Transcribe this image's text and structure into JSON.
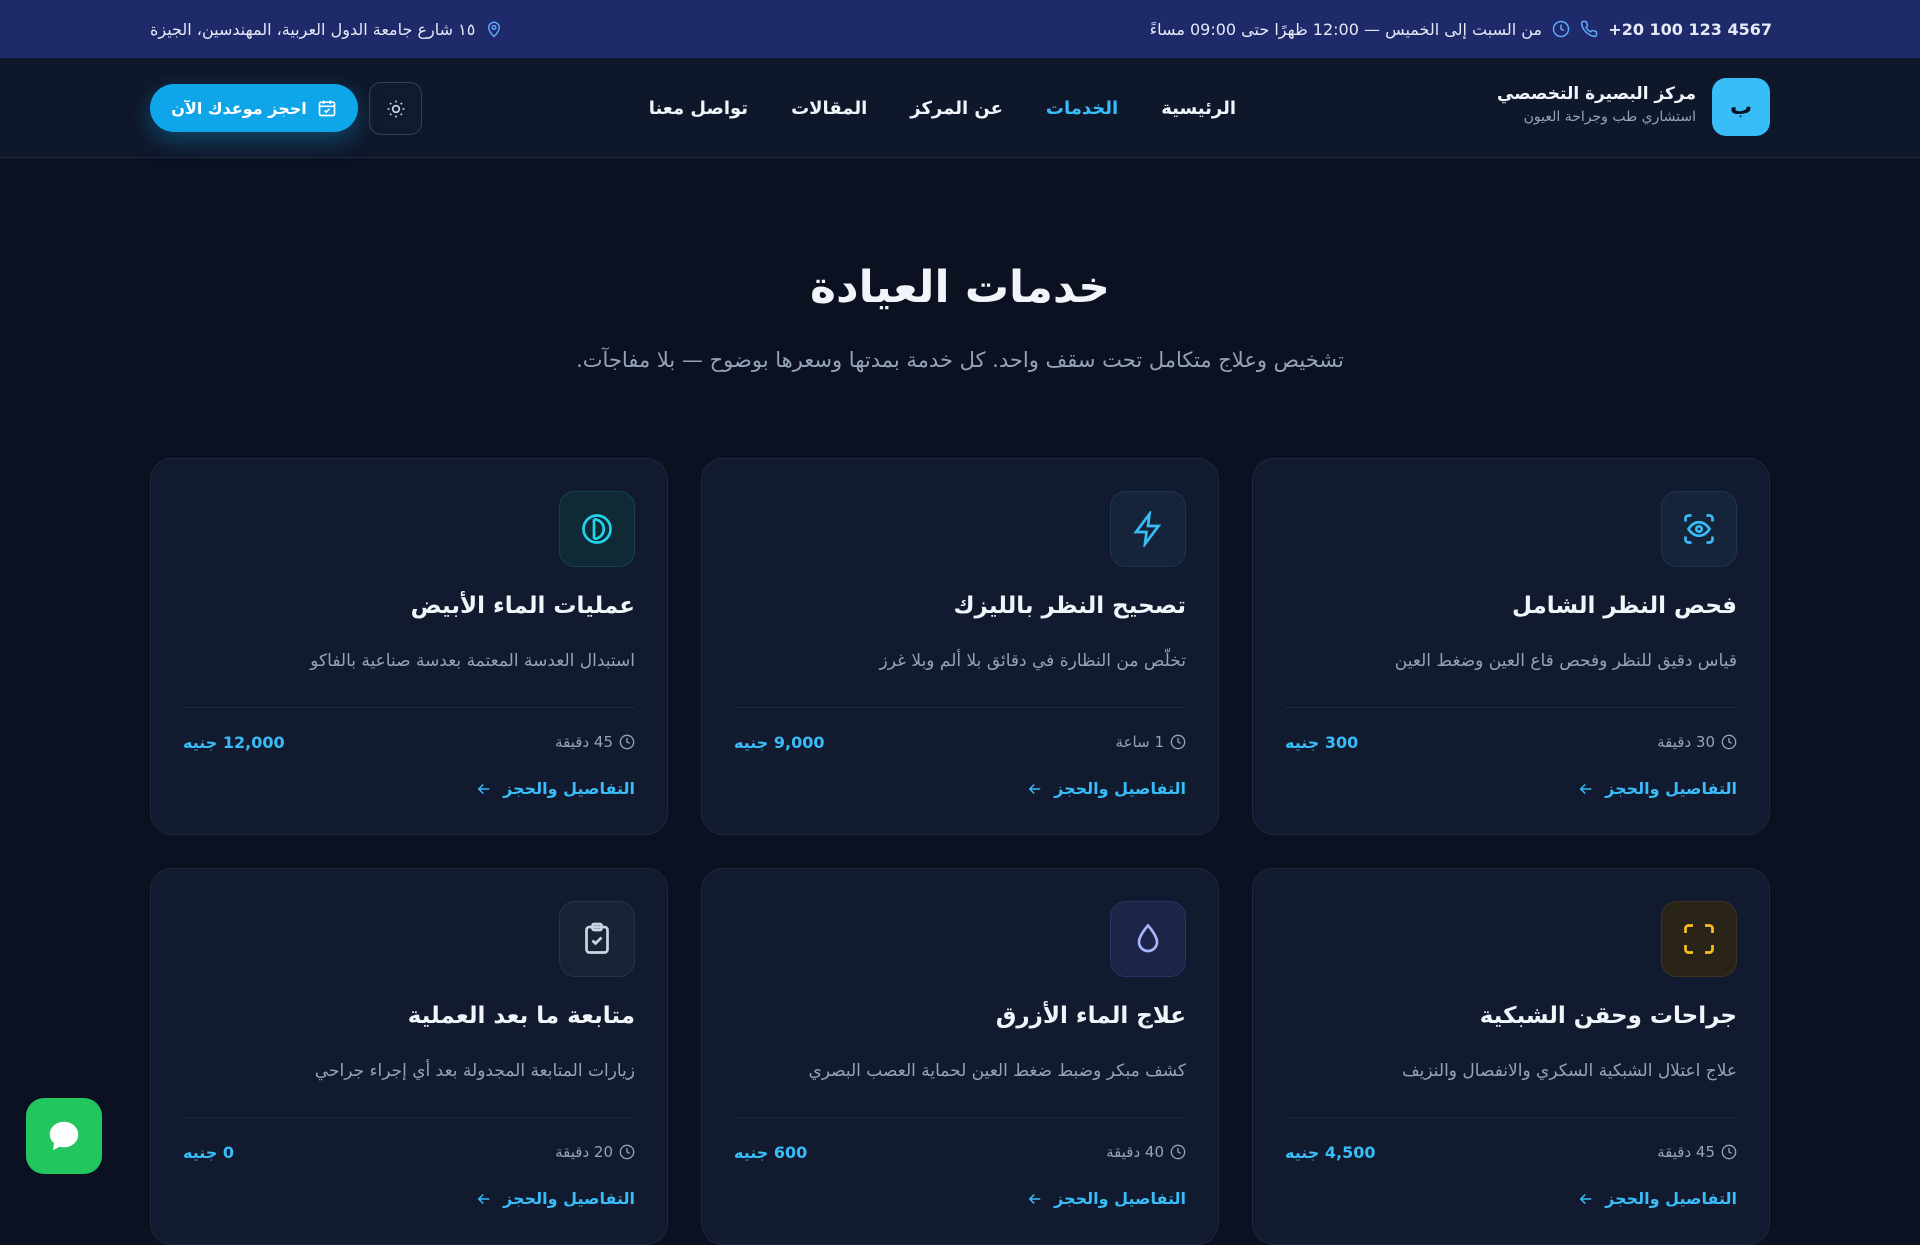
{
  "topbar": {
    "phone": "+20 100 123 4567",
    "hours": "من السبت إلى الخميس — 12:00 ظهرًا حتى 09:00 مساءً",
    "address": "١٥ شارع جامعة الدول العربية، المهندسين، الجيزة"
  },
  "brand": {
    "logo_letter": "ب",
    "name": "مركز البصيرة التخصصي",
    "tagline": "استشاري طب وجراحة العيون"
  },
  "nav": {
    "items": [
      {
        "label": "الرئيسية"
      },
      {
        "label": "الخدمات"
      },
      {
        "label": "عن المركز"
      },
      {
        "label": "المقالات"
      },
      {
        "label": "تواصل معنا"
      }
    ],
    "active_index": 1,
    "cta_label": "احجز موعدك الآن"
  },
  "hero": {
    "title": "خدمات العيادة",
    "subtitle": "تشخيص وعلاج متكامل تحت سقف واحد. كل خدمة بمدتها وسعرها بوضوح — بلا مفاجآت."
  },
  "services": [
    {
      "title": "فحص النظر الشامل",
      "desc": "قياس دقيق للنظر وفحص قاع العين وضغط العين",
      "duration": "30 دقيقة",
      "price": "300 جنيه",
      "link": "التفاصيل والحجز",
      "icon": "eye-scan-icon",
      "icon_color": "#38bdf8",
      "icon_bg": "#15243a"
    },
    {
      "title": "تصحيح النظر بالليزك",
      "desc": "تخلّص من النظارة في دقائق بلا ألم وبلا غرز",
      "duration": "1 ساعة",
      "price": "9,000 جنيه",
      "link": "التفاصيل والحجز",
      "icon": "lightning-icon",
      "icon_color": "#38bdf8",
      "icon_bg": "#15243a"
    },
    {
      "title": "عمليات الماء الأبيض",
      "desc": "استبدال العدسة المعتمة بعدسة صناعية بالفاكو",
      "duration": "45 دقيقة",
      "price": "12,000 جنيه",
      "link": "التفاصيل والحجز",
      "icon": "lens-icon",
      "icon_color": "#22d3ee",
      "icon_bg": "#0f2a35"
    },
    {
      "title": "جراحات وحقن الشبكية",
      "desc": "علاج اعتلال الشبكية السكري والانفصال والنزيف",
      "duration": "45 دقيقة",
      "price": "4,500 جنيه",
      "link": "التفاصيل والحجز",
      "icon": "focus-frame-icon",
      "icon_color": "#fbbf24",
      "icon_bg": "#2a2418"
    },
    {
      "title": "علاج الماء الأزرق",
      "desc": "كشف مبكر وضبط ضغط العين لحماية العصب البصري",
      "duration": "40 دقيقة",
      "price": "600 جنيه",
      "link": "التفاصيل والحجز",
      "icon": "drop-icon",
      "icon_color": "#a5b4fc",
      "icon_bg": "#1c2547"
    },
    {
      "title": "متابعة ما بعد العملية",
      "desc": "زيارات المتابعة المجدولة بعد أي إجراء جراحي",
      "duration": "20 دقيقة",
      "price": "0 جنيه",
      "link": "التفاصيل والحجز",
      "icon": "clipboard-check-icon",
      "icon_color": "#cbd5e1",
      "icon_bg": "#1a2336"
    }
  ],
  "colors": {
    "accent": "#38bdf8",
    "topbar": "#1f2a6b",
    "background": "#0b1120",
    "whatsapp": "#22c55e"
  }
}
